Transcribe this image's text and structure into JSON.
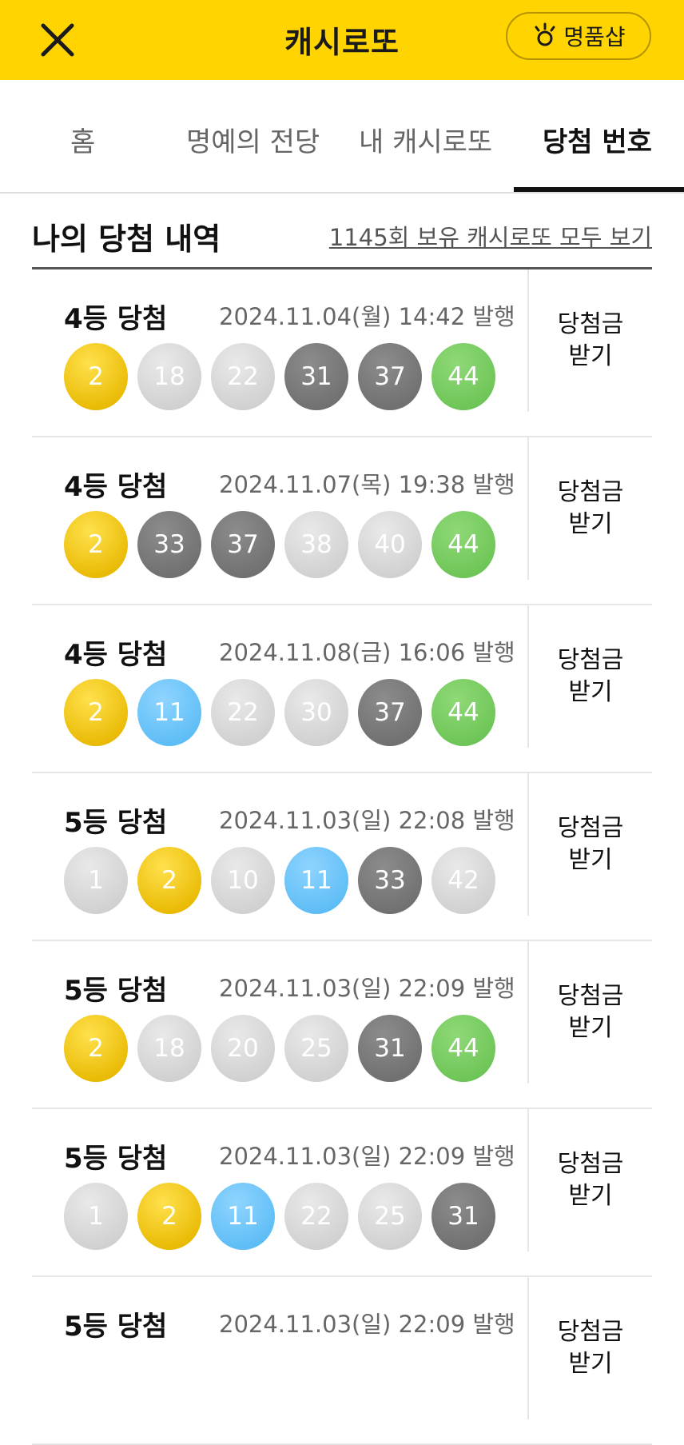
{
  "header": {
    "title": "캐시로또",
    "close_icon": "close-icon",
    "shop_label": "명품샵",
    "shop_icon": "sparkle-icon"
  },
  "tabs": [
    {
      "label": "홈",
      "active": false
    },
    {
      "label": "명예의 전당",
      "active": false
    },
    {
      "label": "내 캐시로또",
      "active": false
    },
    {
      "label": "당첨 번호",
      "active": true
    }
  ],
  "section": {
    "title": "나의 당첨 내역",
    "view_all": "1145회 보유 캐시로또 모두 보기"
  },
  "colors": {
    "brand_yellow": "#FFD400",
    "ball_yellow": "#F2C300",
    "ball_gray": "#D6D6D6",
    "ball_dark": "#777777",
    "ball_blue": "#6CC6FA",
    "ball_green": "#79CC5E"
  },
  "results": [
    {
      "rank": "4등 당첨",
      "date": "2024.11.04(월) 14:42 발행",
      "claim": "당첨금 받기",
      "balls": [
        {
          "n": "2",
          "c": "yellow"
        },
        {
          "n": "18",
          "c": "gray"
        },
        {
          "n": "22",
          "c": "gray"
        },
        {
          "n": "31",
          "c": "dark"
        },
        {
          "n": "37",
          "c": "dark"
        },
        {
          "n": "44",
          "c": "green"
        }
      ]
    },
    {
      "rank": "4등 당첨",
      "date": "2024.11.07(목) 19:38 발행",
      "claim": "당첨금 받기",
      "balls": [
        {
          "n": "2",
          "c": "yellow"
        },
        {
          "n": "33",
          "c": "dark"
        },
        {
          "n": "37",
          "c": "dark"
        },
        {
          "n": "38",
          "c": "gray"
        },
        {
          "n": "40",
          "c": "gray"
        },
        {
          "n": "44",
          "c": "green"
        }
      ]
    },
    {
      "rank": "4등 당첨",
      "date": "2024.11.08(금) 16:06 발행",
      "claim": "당첨금 받기",
      "balls": [
        {
          "n": "2",
          "c": "yellow"
        },
        {
          "n": "11",
          "c": "blue"
        },
        {
          "n": "22",
          "c": "gray"
        },
        {
          "n": "30",
          "c": "gray"
        },
        {
          "n": "37",
          "c": "dark"
        },
        {
          "n": "44",
          "c": "green"
        }
      ]
    },
    {
      "rank": "5등 당첨",
      "date": "2024.11.03(일) 22:08 발행",
      "claim": "당첨금 받기",
      "balls": [
        {
          "n": "1",
          "c": "gray"
        },
        {
          "n": "2",
          "c": "yellow"
        },
        {
          "n": "10",
          "c": "gray"
        },
        {
          "n": "11",
          "c": "blue"
        },
        {
          "n": "33",
          "c": "dark"
        },
        {
          "n": "42",
          "c": "gray"
        }
      ]
    },
    {
      "rank": "5등 당첨",
      "date": "2024.11.03(일) 22:09 발행",
      "claim": "당첨금 받기",
      "balls": [
        {
          "n": "2",
          "c": "yellow"
        },
        {
          "n": "18",
          "c": "gray"
        },
        {
          "n": "20",
          "c": "gray"
        },
        {
          "n": "25",
          "c": "gray"
        },
        {
          "n": "31",
          "c": "dark"
        },
        {
          "n": "44",
          "c": "green"
        }
      ]
    },
    {
      "rank": "5등 당첨",
      "date": "2024.11.03(일) 22:09 발행",
      "claim": "당첨금 받기",
      "balls": [
        {
          "n": "1",
          "c": "gray"
        },
        {
          "n": "2",
          "c": "yellow"
        },
        {
          "n": "11",
          "c": "blue"
        },
        {
          "n": "22",
          "c": "gray"
        },
        {
          "n": "25",
          "c": "gray"
        },
        {
          "n": "31",
          "c": "dark"
        }
      ]
    },
    {
      "rank": "5등 당첨",
      "date": "2024.11.03(일) 22:09 발행",
      "claim": "당첨금 받기",
      "balls": []
    }
  ]
}
